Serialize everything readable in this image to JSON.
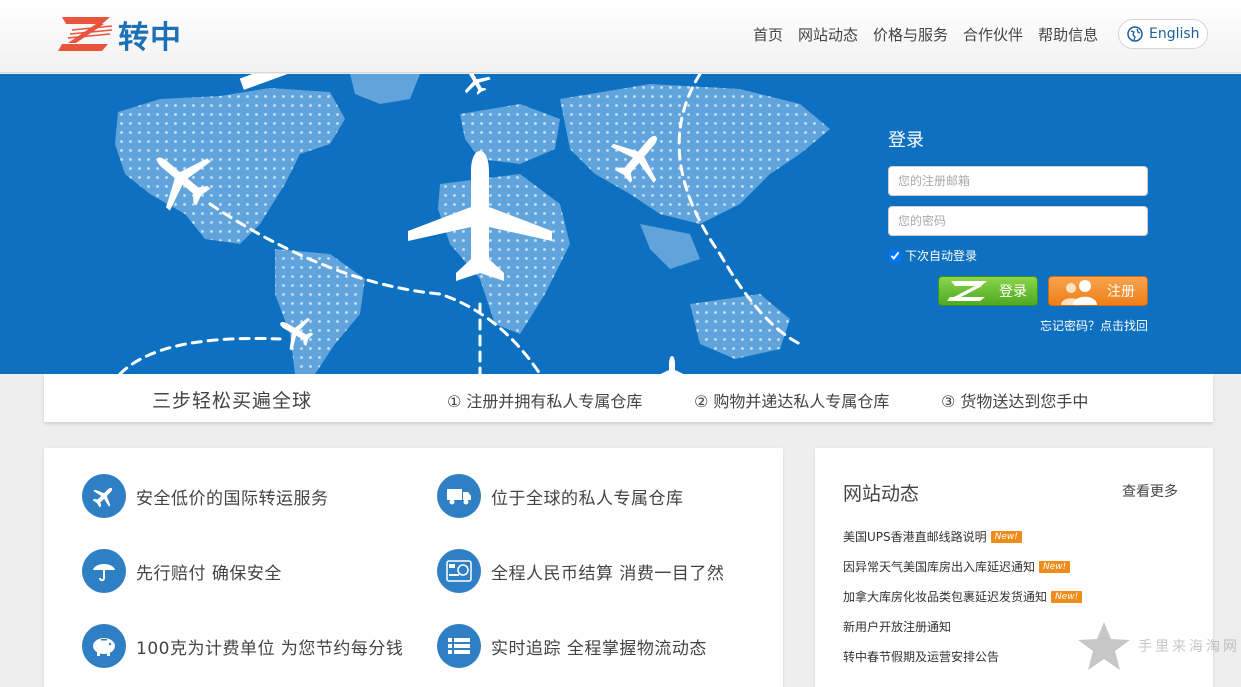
{
  "brand": {
    "name": "转中",
    "accent": "#1d6fb6",
    "logo_red": "#e8553c"
  },
  "nav": {
    "items": [
      "首页",
      "网站动态",
      "价格与服务",
      "合作伙伴",
      "帮助信息"
    ],
    "language": "English"
  },
  "login": {
    "title": "登录",
    "email_placeholder": "您的注册邮箱",
    "password_placeholder": "您的密码",
    "remember_label": "下次自动登录",
    "remember_checked": true,
    "login_button": "登录",
    "register_button": "注册",
    "forgot": "忘记密码？点击找回"
  },
  "steps": {
    "title": "三步轻松买遍全球",
    "items": [
      "① 注册并拥有私人专属仓库",
      "② 购物并递达私人专属仓库",
      "③ 货物送达到您手中"
    ]
  },
  "features": [
    {
      "text": "安全低价的国际转运服务",
      "icon": "airplane-icon"
    },
    {
      "text": "位于全球的私人专属仓库",
      "icon": "truck-icon"
    },
    {
      "text": "先行赔付 确保安全",
      "icon": "umbrella-icon"
    },
    {
      "text": "全程人民币结算 消费一目了然",
      "icon": "currency-icon"
    },
    {
      "text": "100克为计费单位 为您节约每分钱",
      "icon": "piggy-bank-icon"
    },
    {
      "text": "实时追踪 全程掌握物流动态",
      "icon": "list-icon"
    }
  ],
  "news": {
    "title": "网站动态",
    "more": "查看更多",
    "badge": "New!",
    "items": [
      {
        "text": "美国UPS香港直邮线路说明",
        "new": true
      },
      {
        "text": "因异常天气美国库房出入库延迟通知",
        "new": true
      },
      {
        "text": "加拿大库房化妆品类包裹延迟发货通知",
        "new": true
      },
      {
        "text": "新用户开放注册通知",
        "new": false
      },
      {
        "text": "转中春节假期及运营安排公告",
        "new": false
      }
    ]
  },
  "watermark": "手里来海淘网"
}
